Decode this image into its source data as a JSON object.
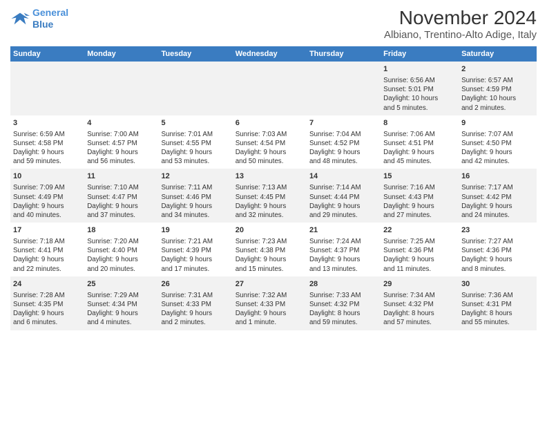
{
  "logo": {
    "line1": "General",
    "line2": "Blue"
  },
  "title": "November 2024",
  "subtitle": "Albiano, Trentino-Alto Adige, Italy",
  "weekdays": [
    "Sunday",
    "Monday",
    "Tuesday",
    "Wednesday",
    "Thursday",
    "Friday",
    "Saturday"
  ],
  "weeks": [
    [
      {
        "day": "",
        "info": ""
      },
      {
        "day": "",
        "info": ""
      },
      {
        "day": "",
        "info": ""
      },
      {
        "day": "",
        "info": ""
      },
      {
        "day": "",
        "info": ""
      },
      {
        "day": "1",
        "info": "Sunrise: 6:56 AM\nSunset: 5:01 PM\nDaylight: 10 hours\nand 5 minutes."
      },
      {
        "day": "2",
        "info": "Sunrise: 6:57 AM\nSunset: 4:59 PM\nDaylight: 10 hours\nand 2 minutes."
      }
    ],
    [
      {
        "day": "3",
        "info": "Sunrise: 6:59 AM\nSunset: 4:58 PM\nDaylight: 9 hours\nand 59 minutes."
      },
      {
        "day": "4",
        "info": "Sunrise: 7:00 AM\nSunset: 4:57 PM\nDaylight: 9 hours\nand 56 minutes."
      },
      {
        "day": "5",
        "info": "Sunrise: 7:01 AM\nSunset: 4:55 PM\nDaylight: 9 hours\nand 53 minutes."
      },
      {
        "day": "6",
        "info": "Sunrise: 7:03 AM\nSunset: 4:54 PM\nDaylight: 9 hours\nand 50 minutes."
      },
      {
        "day": "7",
        "info": "Sunrise: 7:04 AM\nSunset: 4:52 PM\nDaylight: 9 hours\nand 48 minutes."
      },
      {
        "day": "8",
        "info": "Sunrise: 7:06 AM\nSunset: 4:51 PM\nDaylight: 9 hours\nand 45 minutes."
      },
      {
        "day": "9",
        "info": "Sunrise: 7:07 AM\nSunset: 4:50 PM\nDaylight: 9 hours\nand 42 minutes."
      }
    ],
    [
      {
        "day": "10",
        "info": "Sunrise: 7:09 AM\nSunset: 4:49 PM\nDaylight: 9 hours\nand 40 minutes."
      },
      {
        "day": "11",
        "info": "Sunrise: 7:10 AM\nSunset: 4:47 PM\nDaylight: 9 hours\nand 37 minutes."
      },
      {
        "day": "12",
        "info": "Sunrise: 7:11 AM\nSunset: 4:46 PM\nDaylight: 9 hours\nand 34 minutes."
      },
      {
        "day": "13",
        "info": "Sunrise: 7:13 AM\nSunset: 4:45 PM\nDaylight: 9 hours\nand 32 minutes."
      },
      {
        "day": "14",
        "info": "Sunrise: 7:14 AM\nSunset: 4:44 PM\nDaylight: 9 hours\nand 29 minutes."
      },
      {
        "day": "15",
        "info": "Sunrise: 7:16 AM\nSunset: 4:43 PM\nDaylight: 9 hours\nand 27 minutes."
      },
      {
        "day": "16",
        "info": "Sunrise: 7:17 AM\nSunset: 4:42 PM\nDaylight: 9 hours\nand 24 minutes."
      }
    ],
    [
      {
        "day": "17",
        "info": "Sunrise: 7:18 AM\nSunset: 4:41 PM\nDaylight: 9 hours\nand 22 minutes."
      },
      {
        "day": "18",
        "info": "Sunrise: 7:20 AM\nSunset: 4:40 PM\nDaylight: 9 hours\nand 20 minutes."
      },
      {
        "day": "19",
        "info": "Sunrise: 7:21 AM\nSunset: 4:39 PM\nDaylight: 9 hours\nand 17 minutes."
      },
      {
        "day": "20",
        "info": "Sunrise: 7:23 AM\nSunset: 4:38 PM\nDaylight: 9 hours\nand 15 minutes."
      },
      {
        "day": "21",
        "info": "Sunrise: 7:24 AM\nSunset: 4:37 PM\nDaylight: 9 hours\nand 13 minutes."
      },
      {
        "day": "22",
        "info": "Sunrise: 7:25 AM\nSunset: 4:36 PM\nDaylight: 9 hours\nand 11 minutes."
      },
      {
        "day": "23",
        "info": "Sunrise: 7:27 AM\nSunset: 4:36 PM\nDaylight: 9 hours\nand 8 minutes."
      }
    ],
    [
      {
        "day": "24",
        "info": "Sunrise: 7:28 AM\nSunset: 4:35 PM\nDaylight: 9 hours\nand 6 minutes."
      },
      {
        "day": "25",
        "info": "Sunrise: 7:29 AM\nSunset: 4:34 PM\nDaylight: 9 hours\nand 4 minutes."
      },
      {
        "day": "26",
        "info": "Sunrise: 7:31 AM\nSunset: 4:33 PM\nDaylight: 9 hours\nand 2 minutes."
      },
      {
        "day": "27",
        "info": "Sunrise: 7:32 AM\nSunset: 4:33 PM\nDaylight: 9 hours\nand 1 minute."
      },
      {
        "day": "28",
        "info": "Sunrise: 7:33 AM\nSunset: 4:32 PM\nDaylight: 8 hours\nand 59 minutes."
      },
      {
        "day": "29",
        "info": "Sunrise: 7:34 AM\nSunset: 4:32 PM\nDaylight: 8 hours\nand 57 minutes."
      },
      {
        "day": "30",
        "info": "Sunrise: 7:36 AM\nSunset: 4:31 PM\nDaylight: 8 hours\nand 55 minutes."
      }
    ]
  ]
}
